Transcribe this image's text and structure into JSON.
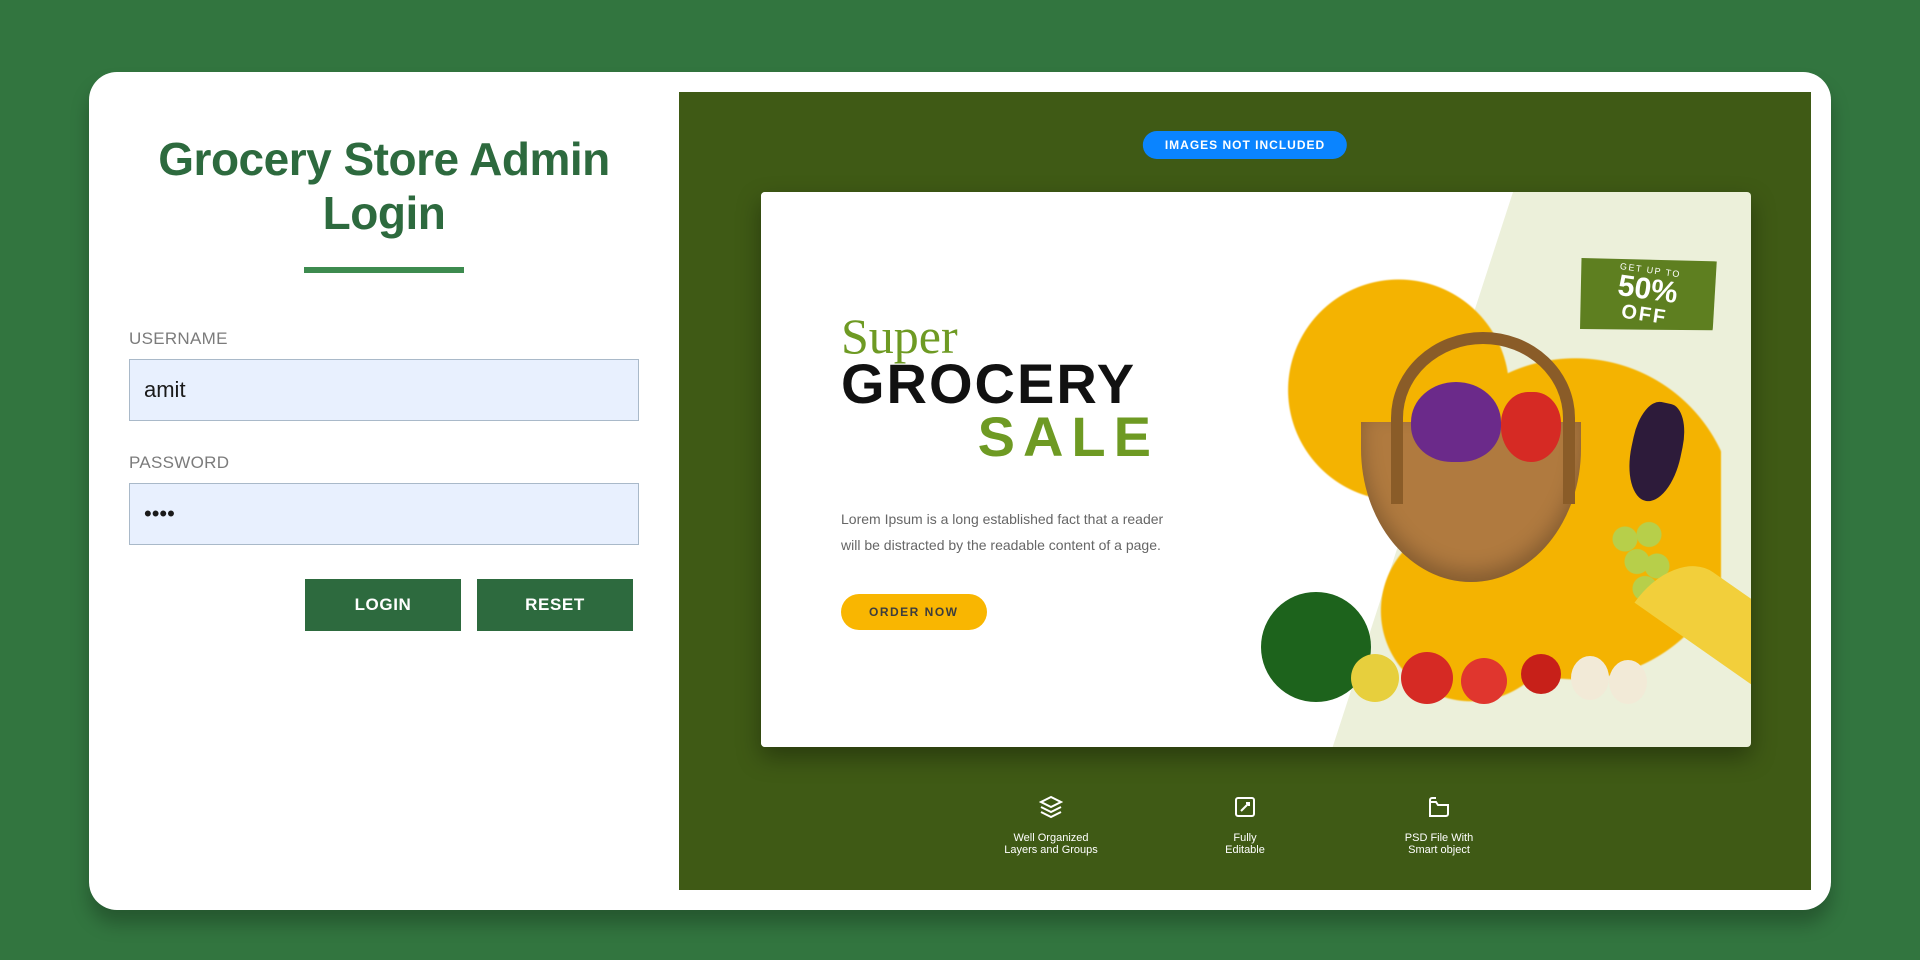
{
  "login": {
    "title": "Grocery Store Admin Login",
    "username_label": "USERNAME",
    "username_value": "amit",
    "password_label": "PASSWORD",
    "password_value": "••••",
    "login_btn": "LOGIN",
    "reset_btn": "RESET"
  },
  "promo": {
    "top_badge": "IMAGES NOT INCLUDED",
    "super": "Super",
    "grocery": "GROCERY",
    "sale": "SALE",
    "body": "Lorem Ipsum is a long established fact that a reader will be distracted by the readable content of a page.",
    "order_btn": "ORDER NOW",
    "offer_mini": "GET UP TO",
    "offer_big": "50%",
    "offer_off": "OFF",
    "features": [
      {
        "label": "Well Organized\nLayers and Groups"
      },
      {
        "label": "Fully\nEditable"
      },
      {
        "label": "PSD File With\nSmart object"
      }
    ]
  }
}
